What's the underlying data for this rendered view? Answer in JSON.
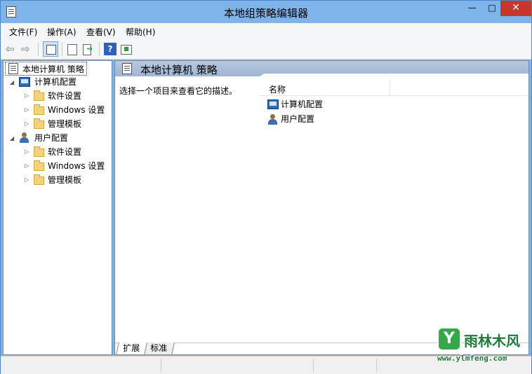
{
  "window": {
    "title": "本地组策略编辑器",
    "minimize_glyph": "—",
    "maximize_glyph": "□",
    "close_glyph": "✕"
  },
  "menu": {
    "items": [
      "文件(F)",
      "操作(A)",
      "查看(V)",
      "帮助(H)"
    ]
  },
  "toolbar": {
    "icons": [
      "back-arrow-icon",
      "forward-arrow-icon",
      "show-tree-icon",
      "properties-icon",
      "export-list-icon",
      "help-icon",
      "view-icon"
    ],
    "help_glyph": "?"
  },
  "tree": {
    "root_label": "本地计算机 策略",
    "computer_config": {
      "label": "计算机配置",
      "children": [
        "软件设置",
        "Windows 设置",
        "管理模板"
      ]
    },
    "user_config": {
      "label": "用户配置",
      "children": [
        "软件设置",
        "Windows 设置",
        "管理模板"
      ]
    }
  },
  "right_pane": {
    "header_title": "本地计算机 策略",
    "description": "选择一个项目来查看它的描述。",
    "column_name": "名称",
    "items": [
      "计算机配置",
      "用户配置"
    ],
    "tabs": [
      "扩展",
      "标准"
    ],
    "active_tab": "扩展"
  },
  "watermark": {
    "brand": "雨林木风",
    "url": "www.ylmfeng.com"
  },
  "colors": {
    "title_bar": "#7eb4ea",
    "close_button": "#c7382c",
    "pane_header": "#a9bdd8"
  }
}
